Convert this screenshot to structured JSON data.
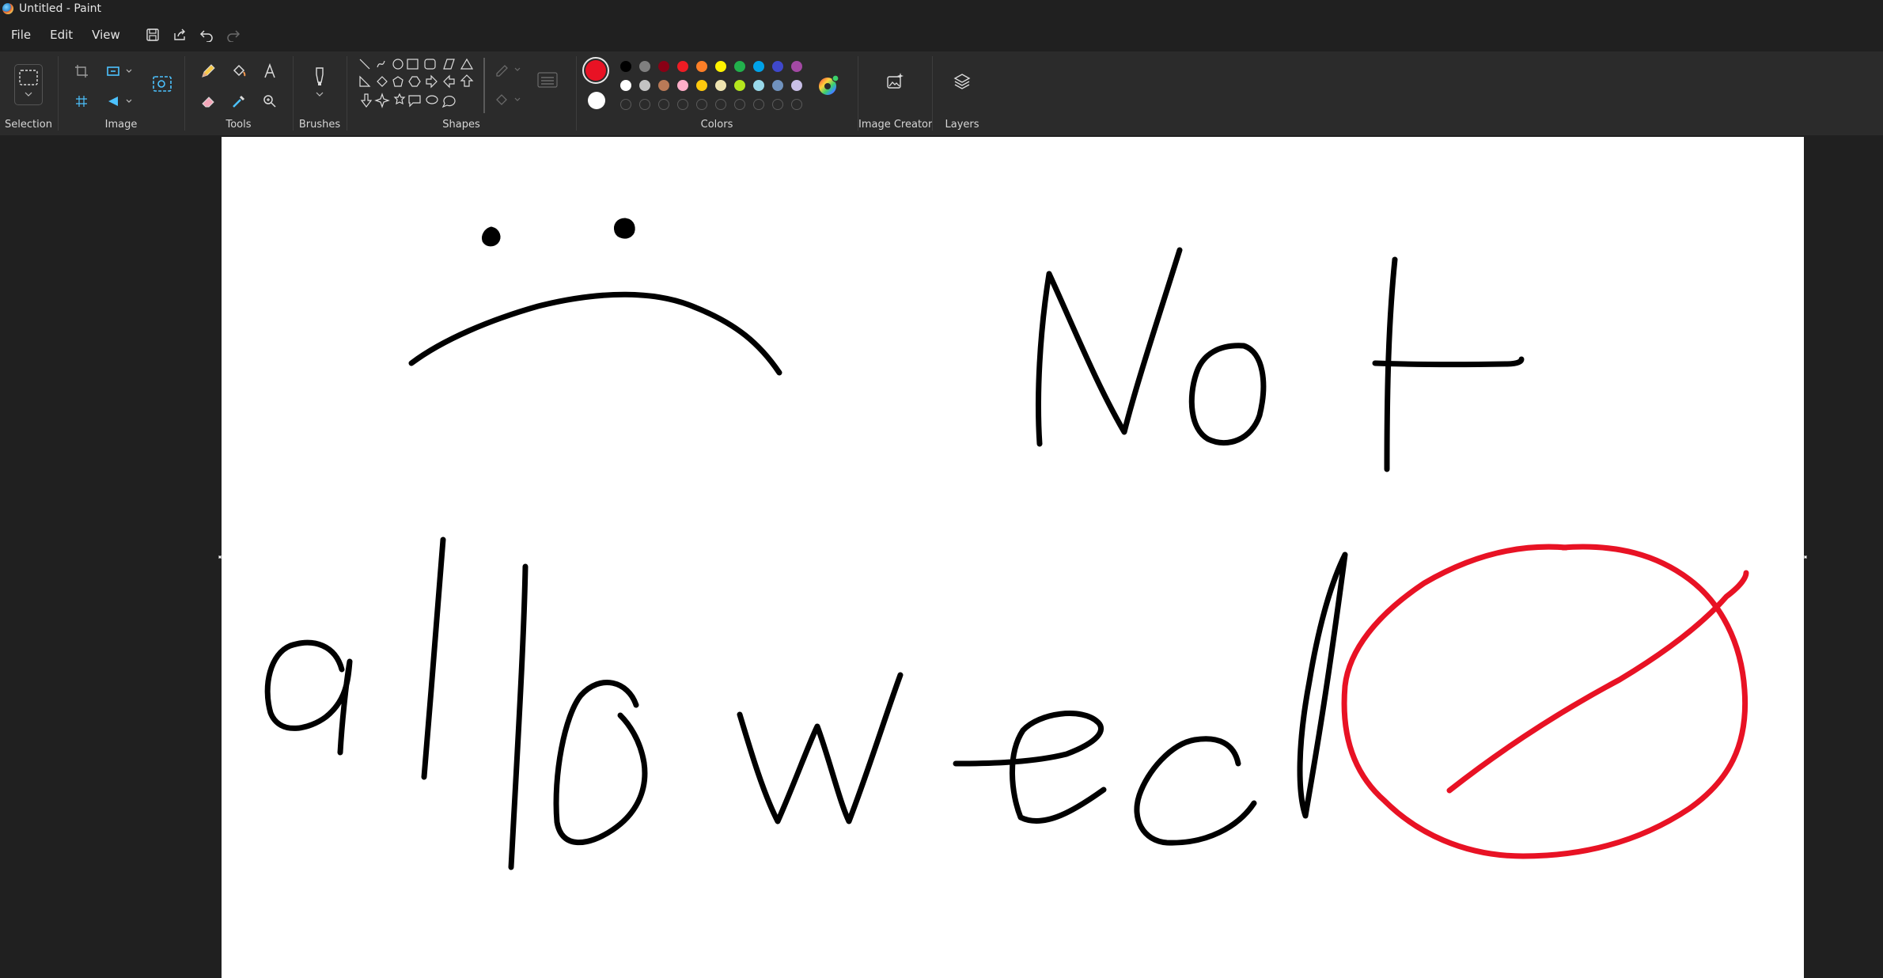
{
  "window": {
    "title": "Untitled - Paint"
  },
  "menu": {
    "file": "File",
    "edit": "Edit",
    "view": "View"
  },
  "quick_access": [
    "save-icon",
    "share-icon",
    "undo-icon",
    "redo-icon"
  ],
  "ribbon": {
    "groups": {
      "selection": "Selection",
      "image": "Image",
      "tools": "Tools",
      "brushes": "Brushes",
      "shapes": "Shapes",
      "colors": "Colors",
      "image_creator": "Image Creator",
      "layers": "Layers"
    },
    "colors": {
      "primary": "#e81224",
      "secondary": "#ffffff",
      "palette_row1": [
        "#000000",
        "#7f7f7f",
        "#880015",
        "#ed1c24",
        "#ff7f27",
        "#fff200",
        "#22b14c",
        "#00a2e8",
        "#3f48cc",
        "#a349a4"
      ],
      "palette_row2": [
        "#ffffff",
        "#c3c3c3",
        "#b97a57",
        "#ffaec9",
        "#ffc90e",
        "#efe4b0",
        "#b5e61d",
        "#99d9ea",
        "#7092be",
        "#c8bfe7"
      ],
      "custom_slots": 10
    }
  },
  "canvas": {
    "background": "#ffffff",
    "ink_black": "#000000",
    "ink_red": "#e81224"
  }
}
